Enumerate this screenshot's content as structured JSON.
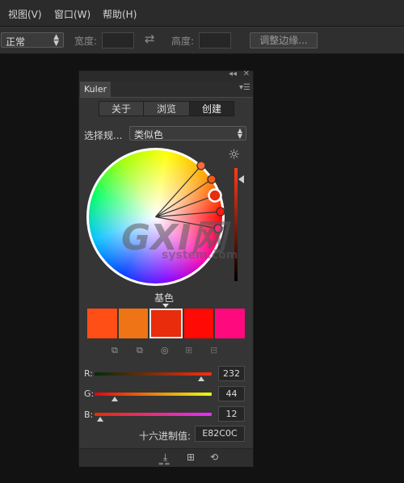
{
  "menu": [
    "视图(V)",
    "窗口(W)",
    "帮助(H)"
  ],
  "options": {
    "mode_select": "正常",
    "width_label": "宽度:",
    "height_label": "高度:",
    "refine_button": "调整边缘..."
  },
  "panel": {
    "tab": "Kuler",
    "segments": [
      "关于",
      "浏览",
      "创建"
    ],
    "rule_label": "选择规...",
    "rule_value": "类似色",
    "base_label": "基色",
    "swatch_colors": [
      "#ff4e16",
      "#ef7415",
      "#e82c0c",
      "#ff0a04",
      "#ff0a7e"
    ],
    "selected_swatch": 2,
    "sliders": [
      {
        "label": "R:",
        "value": "232",
        "fraction": 0.91
      },
      {
        "label": "G:",
        "value": "44",
        "fraction": 0.17
      },
      {
        "label": "B:",
        "value": "12",
        "fraction": 0.05
      }
    ],
    "hex_label": "十六进制值:",
    "hex_value": "E82C0C"
  },
  "watermark": {
    "big": "GXI网",
    "small": "system.com"
  }
}
